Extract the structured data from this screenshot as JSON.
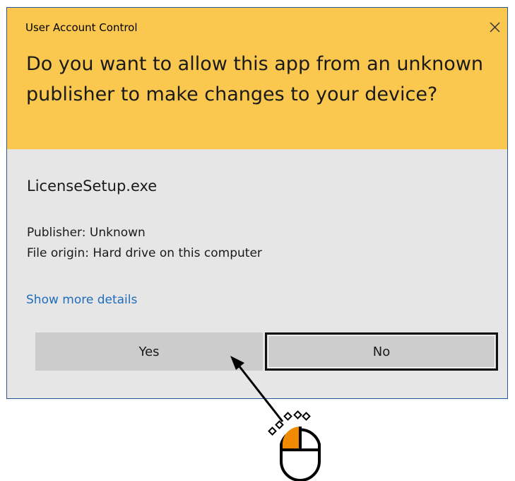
{
  "window": {
    "title": "User Account Control",
    "prompt": "Do you want to allow this app from an unknown publisher to make changes to your device?"
  },
  "app": {
    "name": "LicenseSetup.exe",
    "publisher": "Publisher: Unknown",
    "origin": "File origin: Hard drive on this computer"
  },
  "links": {
    "show_more": "Show more details"
  },
  "buttons": {
    "yes": "Yes",
    "no": "No"
  },
  "icons": {
    "close": "close-icon",
    "pointer": "arrow-icon",
    "mouse": "mouse-left-click-icon"
  },
  "colors": {
    "header": "#fbc84f",
    "body": "#e6e6e6",
    "link": "#1f6dbb",
    "button": "#cccccc",
    "mouse_click": "#f08a00"
  }
}
